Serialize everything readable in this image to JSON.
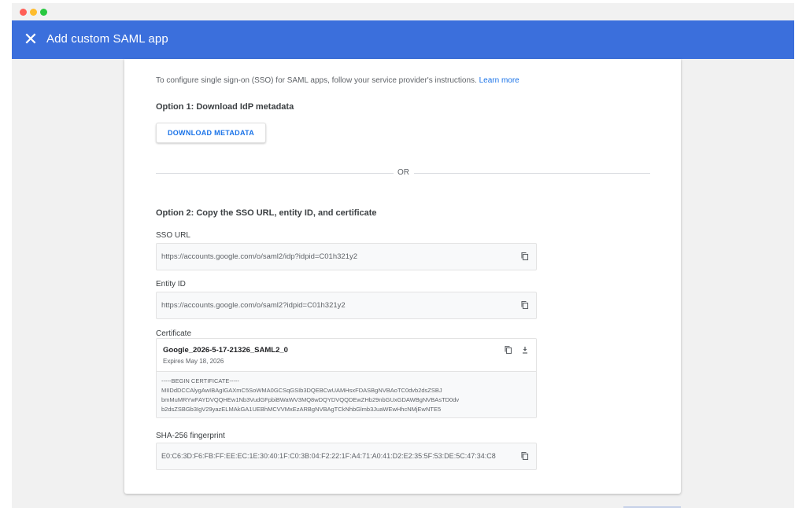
{
  "header": {
    "title": "Add custom SAML app",
    "close_icon": "close-icon",
    "color": "#3b6fdc"
  },
  "intro": {
    "text": "To configure single sign-on (SSO) for SAML apps, follow your service provider's instructions.",
    "link": "Learn more"
  },
  "option1": {
    "heading": "Option 1: Download IdP metadata",
    "button": "DOWNLOAD METADATA"
  },
  "divider": {
    "text": "OR"
  },
  "option2": {
    "heading": "Option 2: Copy the SSO URL, entity ID, and certificate",
    "sso": {
      "label": "SSO URL",
      "value": "https://accounts.google.com/o/saml2/idp?idpid=C01h321y2"
    },
    "entity": {
      "label": "Entity ID",
      "value": "https://accounts.google.com/o/saml2?idpid=C01h321y2"
    },
    "certificate": {
      "label": "Certificate",
      "name": "Google_2026-5-17-21326_SAML2_0",
      "expires": "Expires May 18, 2026",
      "lines": [
        "-----BEGIN CERTIFICATE-----",
        "MIIDdDCCAlygAwIBAgIGAXmC5SoWMA0GCSqGSIb3DQEBCwUAMHsxFDASBgNVBAoTC0dvb2dsZSBJ",
        "bmMuMRYwFAYDVQQHEw1Nb3VudGFpbiBWaWV3MQ8wDQYDVQQDEwZHb29nbGUxGDAWBgNVBAsTD0dv",
        "b2dsZSBGb3IgV29yazELMAkGA1UEBhMCVVMxEzARBgNVBAgTCkNhbGlmb3JuaWEwHhcNMjEwNTE5"
      ]
    },
    "fingerprint": {
      "label": "SHA-256 fingerprint",
      "value": "E0:C6:3D:F6:FB:FF:EE:EC:1E:30:40:1F:C0:3B:04:F2:22:1F:A4:71:A0:41:D2:E2:35:5F:53:DE:5C:47:34:C8"
    }
  },
  "icons": {
    "copy": "copy-icon",
    "download": "download-icon"
  }
}
